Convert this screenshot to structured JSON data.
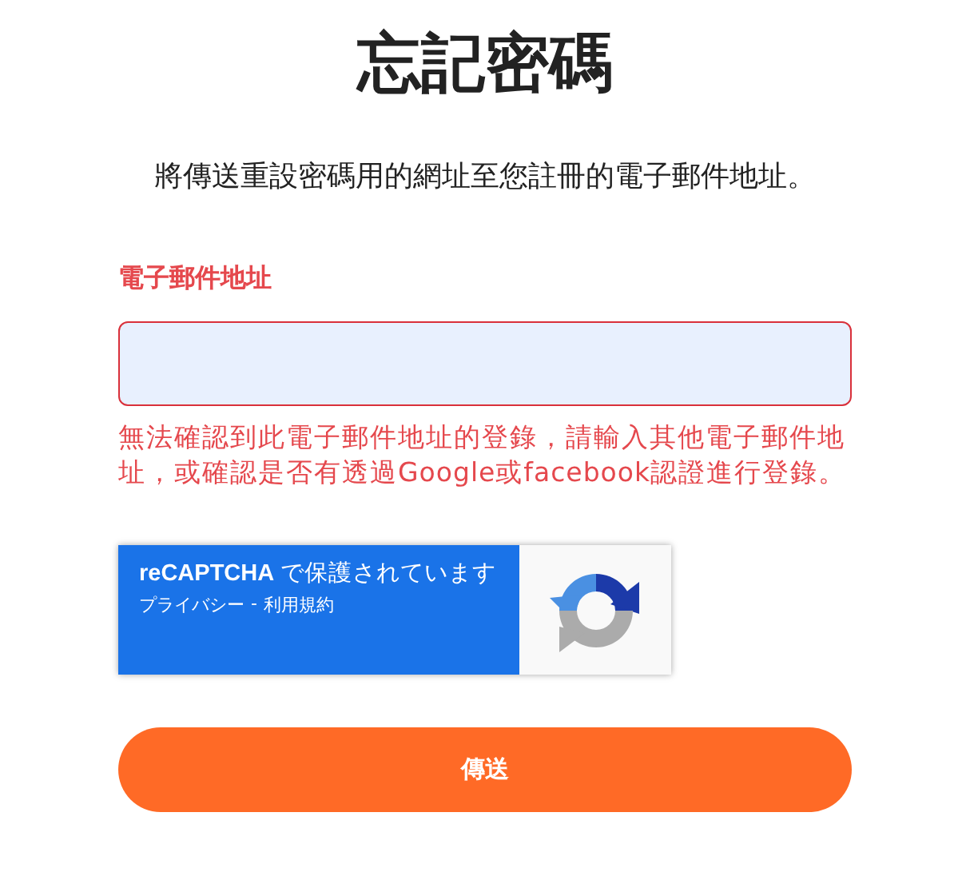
{
  "title": "忘記密碼",
  "description": "將傳送重設密碼用的網址至您註冊的電子郵件地址。",
  "email_field": {
    "label": "電子郵件地址",
    "error": true,
    "error_message": "無法確認到此電子郵件地址的登錄，請輸入其他電子郵件地址，或確認是否有透過Google或facebook認證進行登錄。"
  },
  "recaptcha": {
    "text": "**reCAPTCHA** で保護されています",
    "links": [
      "プライバシー",
      "利用規約"
    ],
    "separator": "-"
  },
  "submit_button": "傳送"
}
